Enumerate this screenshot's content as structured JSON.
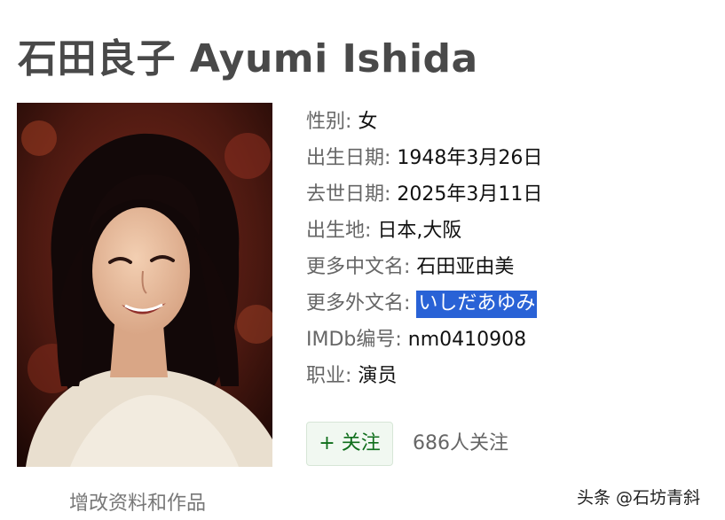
{
  "header": {
    "title": "石田良子 Ayumi Ishida"
  },
  "profile": {
    "fields": [
      {
        "label": "性别:",
        "value": "女"
      },
      {
        "label": "出生日期:",
        "value": "1948年3月26日"
      },
      {
        "label": "去世日期:",
        "value": "2025年3月11日"
      },
      {
        "label": "出生地:",
        "value": "日本,大阪"
      },
      {
        "label": "更多中文名:",
        "value": "石田亚由美"
      },
      {
        "label": "更多外文名:",
        "value": "いしだあゆみ",
        "selected": true
      },
      {
        "label": "IMDb编号:",
        "value": "nm0410908"
      },
      {
        "label": "职业:",
        "value": "演员"
      }
    ]
  },
  "follow": {
    "button_label": "+ 关注",
    "count_text": "686人关注"
  },
  "edit_link": "增改资料和作品",
  "watermark": "头条 @石坊青斜",
  "colors": {
    "selection": "#2962d6",
    "follow_text": "#0f6e1b",
    "follow_bg": "#f1f8f1"
  }
}
